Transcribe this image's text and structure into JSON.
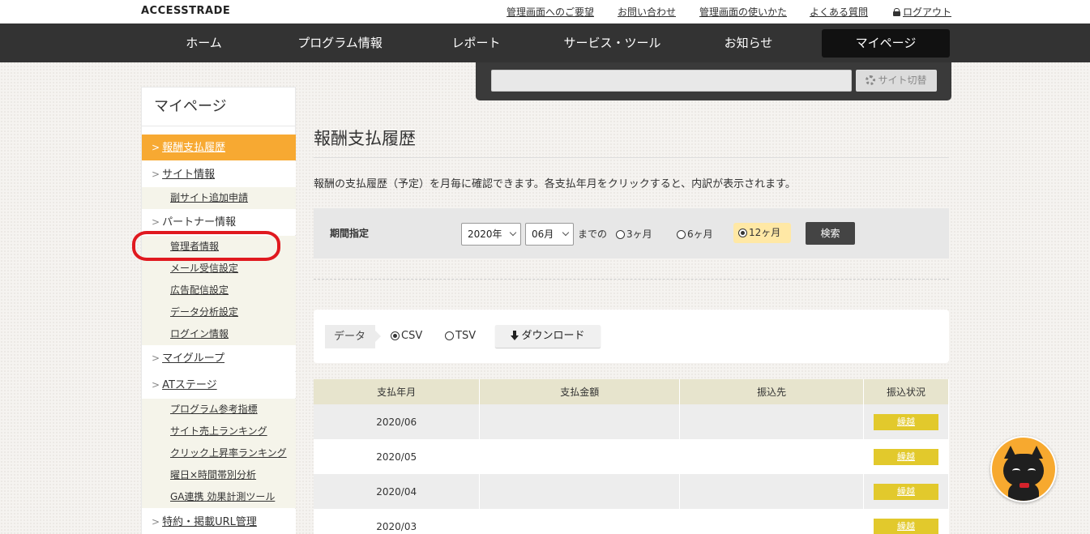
{
  "brand": "ACCESSTRADE",
  "top_links": {
    "feedback": "管理画面へのご要望",
    "contact": "お問い合わせ",
    "howto": "管理画面の使いかた",
    "faq": "よくある質問",
    "logout": "ログアウト"
  },
  "nav": {
    "home": "ホーム",
    "programs": "プログラム情報",
    "report": "レポート",
    "tools": "サービス・ツール",
    "news": "お知らせ",
    "mypage": "マイページ"
  },
  "site_switch": {
    "input_value": "",
    "button_label": "サイト切替"
  },
  "sidebar": {
    "title": "マイページ",
    "payment_history": "報酬支払履歴",
    "site_info": "サイト情報",
    "add_sub_site": "副サイト追加申請",
    "partner_info": "パートナー情報",
    "admin_info": "管理者情報",
    "mail_settings": "メール受信設定",
    "ad_settings": "広告配信設定",
    "data_analysis": "データ分析設定",
    "login_info": "ログイン情報",
    "my_group": "マイグループ",
    "at_stage": "ATステージ",
    "program_index": "プログラム参考指標",
    "site_sales_ranking": "サイト売上ランキング",
    "click_ranking": "クリック上昇率ランキング",
    "weekday_analysis": "曜日×時間帯別分析",
    "ga_tool": "GA連携 効果計測ツール",
    "special_url": "特約・掲載URL管理"
  },
  "main": {
    "title": "報酬支払履歴",
    "description": "報酬の支払履歴（予定）を月毎に確認できます。各支払年月をクリックすると、内訳が表示されます。"
  },
  "filter": {
    "label": "期間指定",
    "year": "2020年",
    "month": "06月",
    "until": "までの",
    "opt3": "3ヶ月",
    "opt6": "6ヶ月",
    "opt12": "12ヶ月",
    "selected": "12ヶ月",
    "search": "検索"
  },
  "download": {
    "label": "データ",
    "csv": "CSV",
    "tsv": "TSV",
    "selected": "CSV",
    "button": "ダウンロード"
  },
  "table": {
    "headers": [
      "支払年月",
      "支払金額",
      "振込先",
      "振込状況"
    ],
    "rows": [
      {
        "month": "2020/06",
        "amount": "",
        "bank": "",
        "status": "繰越"
      },
      {
        "month": "2020/05",
        "amount": "",
        "bank": "",
        "status": "繰越"
      },
      {
        "month": "2020/04",
        "amount": "",
        "bank": "",
        "status": "繰越"
      },
      {
        "month": "2020/03",
        "amount": "",
        "bank": "",
        "status": "繰越"
      }
    ]
  },
  "colors": {
    "nav_bg": "#333333",
    "sidebar_active": "#f7a932",
    "status_badge": "#e2c92c",
    "annotation_red": "#e0191f"
  }
}
